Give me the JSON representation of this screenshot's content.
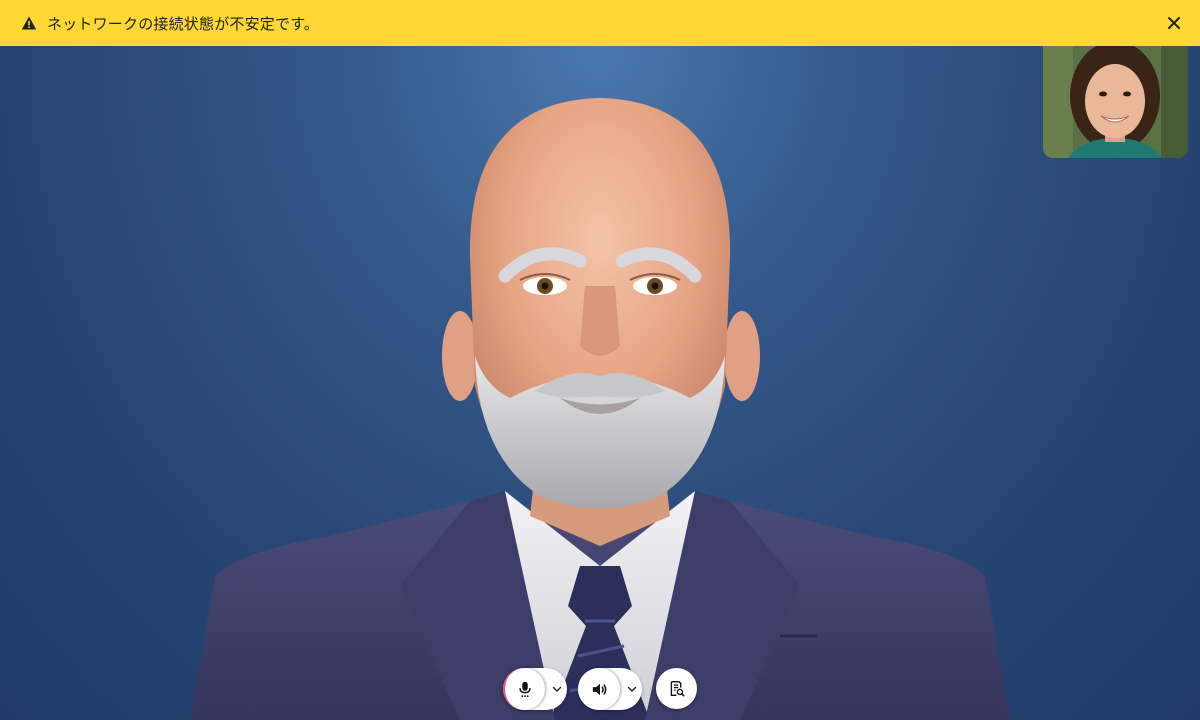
{
  "banner": {
    "message": "ネットワークの接続状態が不安定です。",
    "icon": "warning-icon",
    "close_icon": "close-icon",
    "background": "#fdd835"
  },
  "stage": {
    "background": "#2a4a7a",
    "avatar": "digital-human-avatar"
  },
  "self_view": {
    "icon": "self-view-thumbnail"
  },
  "controls": {
    "microphone_icon": "microphone-icon",
    "speaker_icon": "speaker-icon",
    "transcript_icon": "transcript-search-icon",
    "dropdown_icon": "chevron-down-icon"
  }
}
